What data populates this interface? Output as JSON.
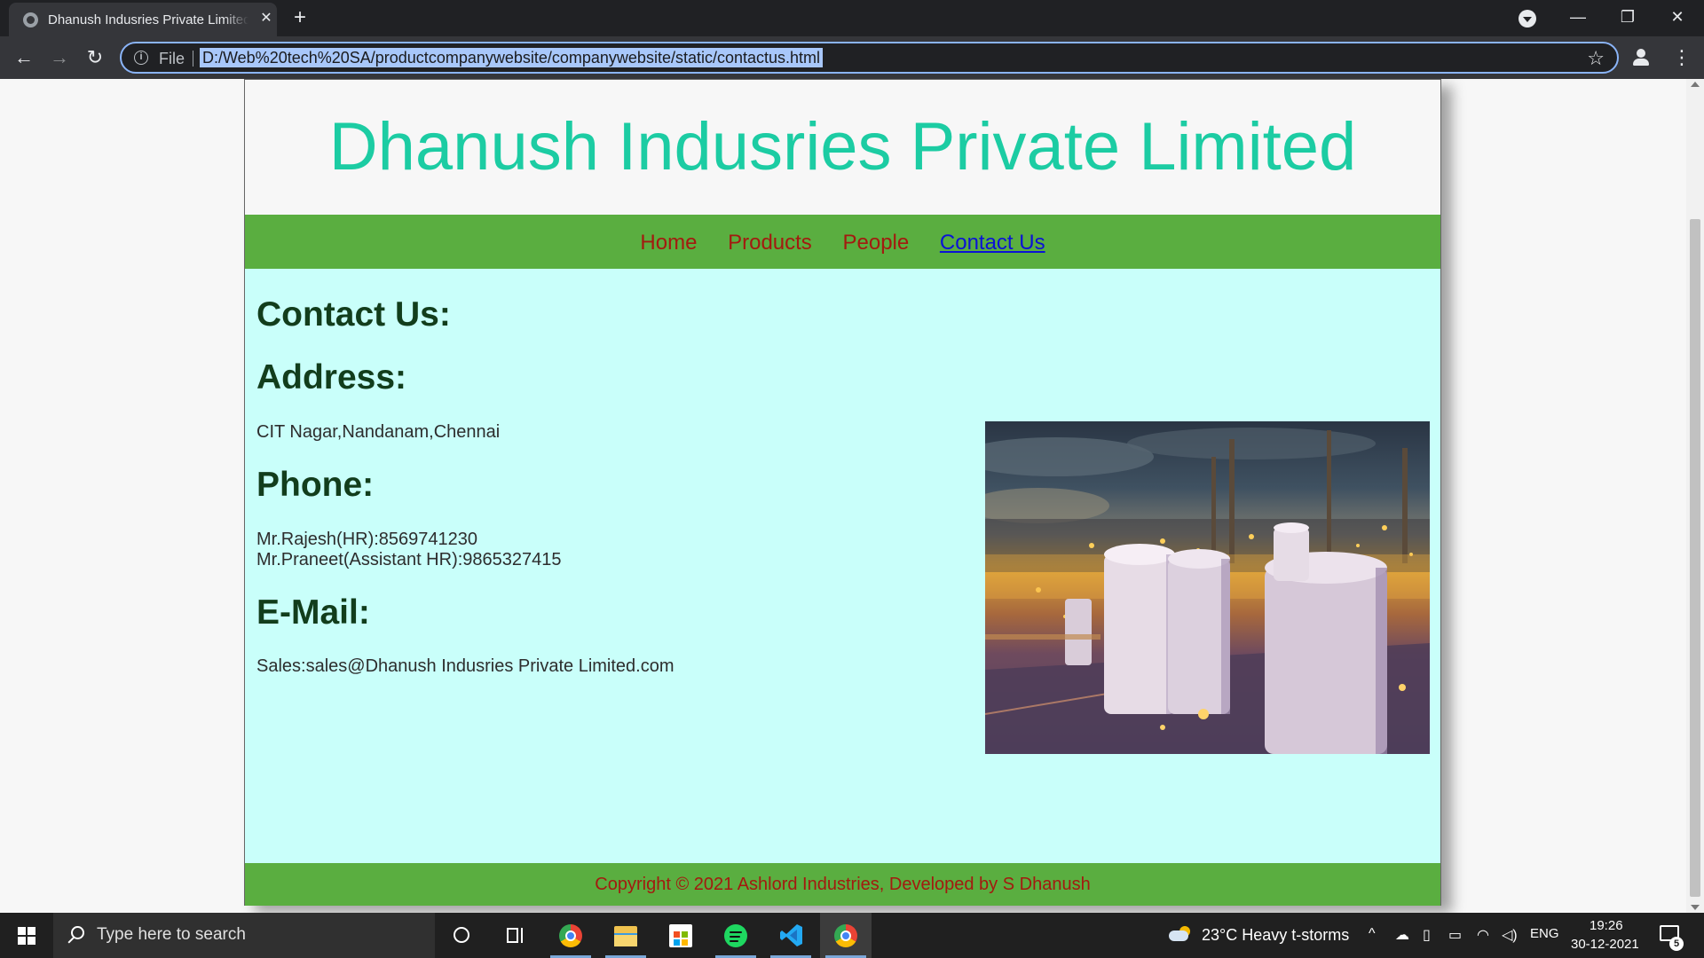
{
  "browser": {
    "tab_title": "Dhanush Indusries Private Limited",
    "tab_close": "✕",
    "new_tab": "+",
    "url_scheme": "File",
    "url": "D:/Web%20tech%20SA/productcompanywebsite/companywebsite/static/contactus.html",
    "window_controls": {
      "minimize": "—",
      "restore": "❐",
      "close": "✕"
    },
    "icons": [
      "info-icon",
      "star-icon",
      "profile-icon",
      "menu-icon",
      "back-icon",
      "forward-icon",
      "reload-icon",
      "tab-search-icon"
    ]
  },
  "site": {
    "title": "Dhanush Indusries Private Limited",
    "nav": [
      {
        "label": "Home",
        "active": false
      },
      {
        "label": "Products",
        "active": false
      },
      {
        "label": "People",
        "active": false
      },
      {
        "label": "Contact Us",
        "active": true
      }
    ],
    "contact": {
      "heading": "Contact Us:",
      "address_heading": "Address:",
      "address": "CIT Nagar,Nandanam,Chennai",
      "phone_heading": "Phone:",
      "phone_1": "Mr.Rajesh(HR):8569741230",
      "phone_2": "Mr.Praneet(Assistant HR):9865327415",
      "email_heading": "E-Mail:",
      "email": "Sales:sales@Dhanush Indusries Private Limited.com"
    },
    "footer": "Copyright © 2021 Ashlord Industries, Developed by S Dhanush"
  },
  "colors": {
    "title": "#1ccca3",
    "nav_bar": "#5aae40",
    "nav_link": "#a31a0f",
    "nav_active": "#0b12d6",
    "content_bg": "#c9fffa",
    "heading": "#123d1c"
  },
  "taskbar": {
    "search_placeholder": "Type here to search",
    "weather": "23°C  Heavy t-storms",
    "language": "ENG",
    "time": "19:26",
    "date": "30-12-2021",
    "notifications": "5",
    "apps": [
      "cortana-icon",
      "task-view-icon",
      "chrome-icon",
      "file-explorer-icon",
      "store-icon",
      "spotify-icon",
      "vscode-icon",
      "chrome-icon"
    ]
  }
}
